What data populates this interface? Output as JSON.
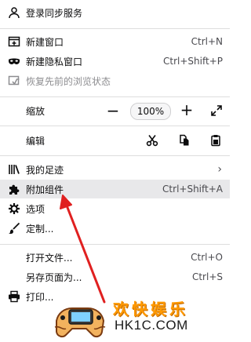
{
  "menu": {
    "sign_in": "登录同步服务",
    "new_window": {
      "label": "新建窗口",
      "shortcut": "Ctrl+N"
    },
    "new_private": {
      "label": "新建隐私窗口",
      "shortcut": "Ctrl+Shift+P"
    },
    "restore_session": "恢复先前的浏览状态",
    "zoom": {
      "label": "缩放",
      "value": "100%",
      "minus": "−",
      "plus": "+"
    },
    "edit": "编辑",
    "library": "我的足迹",
    "addons": {
      "label": "附加组件",
      "shortcut": "Ctrl+Shift+A"
    },
    "options": "选项",
    "customize": "定制...",
    "open_file": {
      "label": "打开文件...",
      "shortcut": "Ctrl+O"
    },
    "save_page": {
      "label": "另存页面为...",
      "shortcut": "Ctrl+S"
    },
    "print": "打印..."
  },
  "watermark": {
    "title": "欢快娱乐",
    "site": "HK1C.COM"
  },
  "colors": {
    "hover_background": "#e8e8ea",
    "annotation_arrow": "#e02020",
    "watermark_orange": "#ff9900"
  }
}
